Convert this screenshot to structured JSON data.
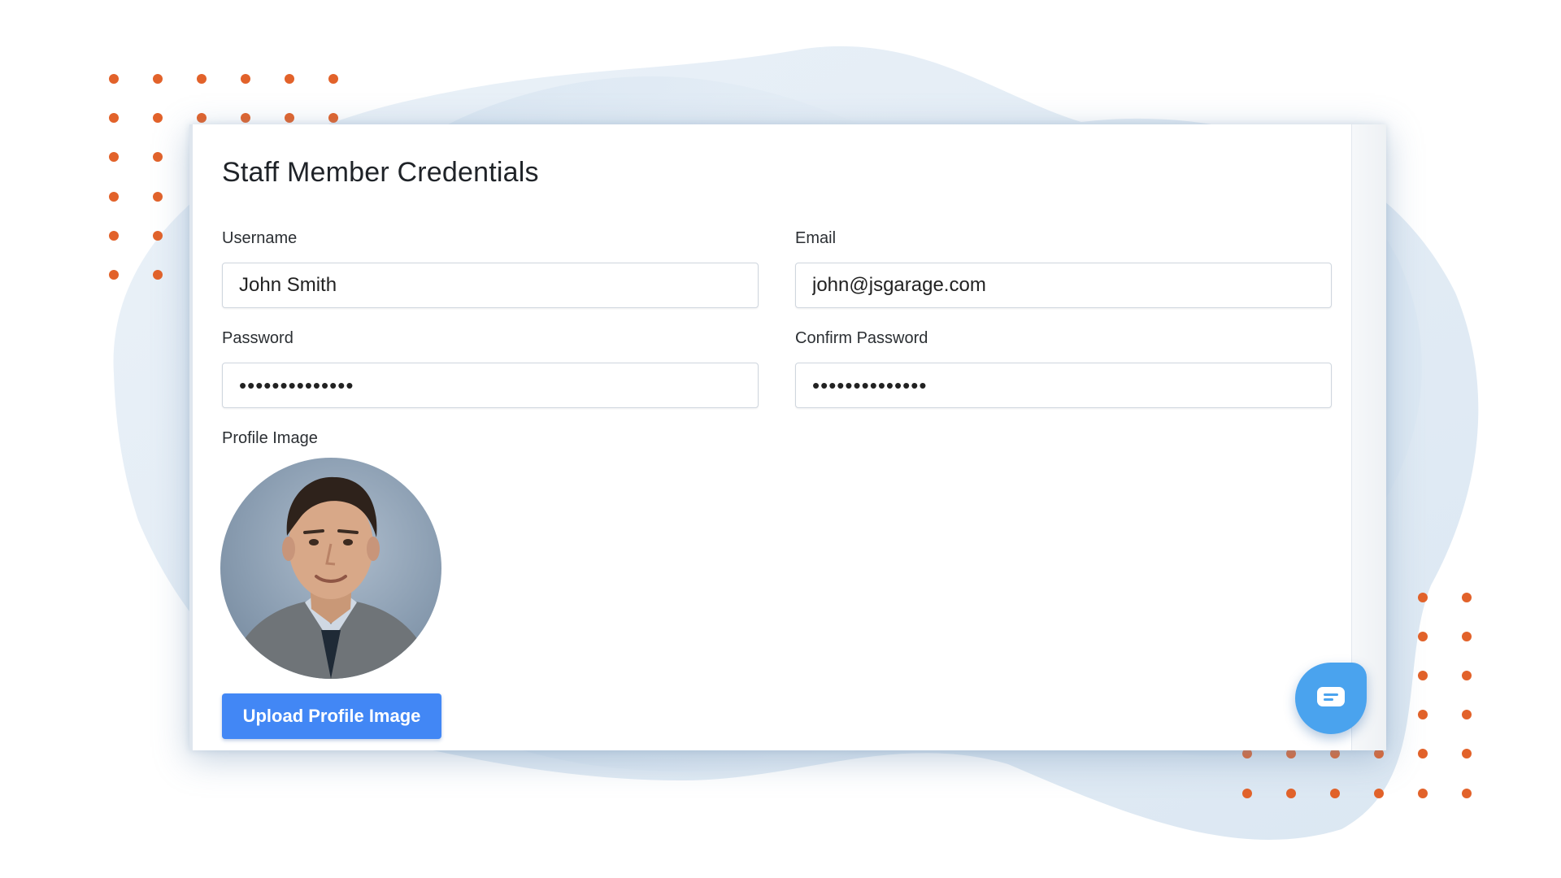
{
  "form": {
    "title": "Staff Member Credentials",
    "username": {
      "label": "Username",
      "value": "John Smith"
    },
    "email": {
      "label": "Email",
      "value": "john@jsgarage.com"
    },
    "password": {
      "label": "Password",
      "value": "••••••••••••••"
    },
    "confirm_password": {
      "label": "Confirm Password",
      "value": "••••••••••••••"
    },
    "profile_image": {
      "label": "Profile Image"
    },
    "upload_button": "Upload Profile Image"
  },
  "chat": {
    "icon": "chat-icon"
  },
  "colors": {
    "accent": "#4287f5",
    "chat_bubble": "#4aa3ee",
    "dots": "#e2622a",
    "blob": "#dce8f3"
  }
}
